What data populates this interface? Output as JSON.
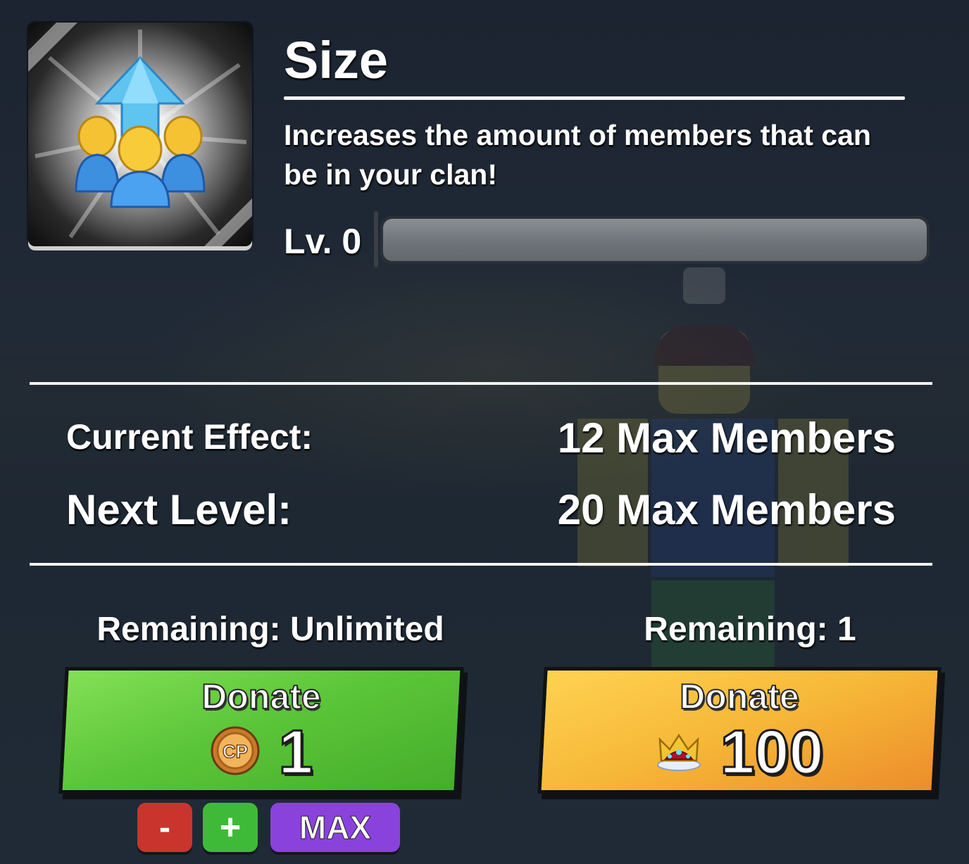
{
  "upgrade": {
    "title": "Size",
    "description": "Increases the amount of members that can be in your clan!",
    "level_label": "Lv. 0",
    "progress": 0,
    "icon": "clan-size-upgrade-icon"
  },
  "stats": {
    "current_label": "Current Effect:",
    "current_value": "12 Max Members",
    "next_label": "Next Level:",
    "next_value": "20 Max Members"
  },
  "donate_coins": {
    "remaining": "Remaining: Unlimited",
    "label": "Donate",
    "amount": "1",
    "currency_icon": "cp-coin-icon",
    "color": "#5cc639"
  },
  "donate_crowns": {
    "remaining": "Remaining: 1",
    "label": "Donate",
    "amount": "100",
    "currency_icon": "crown-icon",
    "color": "#f6b737"
  },
  "controls": {
    "minus": "-",
    "plus": "+",
    "max": "MAX"
  }
}
